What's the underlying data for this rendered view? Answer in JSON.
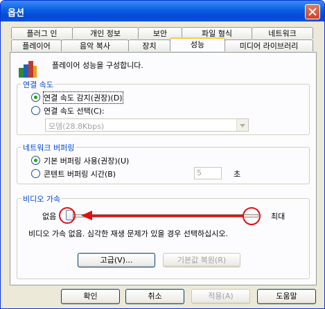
{
  "window": {
    "title": "옵션"
  },
  "tabs_back": [
    "플러그 인",
    "개인 정보",
    "보안",
    "파일 형식",
    "네트워크"
  ],
  "tabs_front": [
    "플레이어",
    "음악 복사",
    "장치",
    "성능",
    "미디어 라이브러리"
  ],
  "active_tab": "성능",
  "heading": "플레이어 성능을 구성합니다.",
  "connection": {
    "legend": "연결 속도",
    "detect_label": "연결 속도 감지(권장)(D)",
    "choose_label": "연결 속도 선택(C):",
    "speed_value": "모뎀(28.8Kbps)"
  },
  "buffering": {
    "legend": "네트워크 버퍼링",
    "default_label": "기본 버퍼링 사용(권장)(U)",
    "custom_label": "콘텐트 버퍼링 시간(B)",
    "seconds_value": "5",
    "seconds_unit": "초"
  },
  "acceleration": {
    "legend": "비디오 가속",
    "min_label": "없음",
    "max_label": "최대",
    "level_fraction": 0.0,
    "description": "비디오 가속 없음. 심각한 재생 문제가 있을 경우 선택하십시오.",
    "advanced_label": "고급(V)...",
    "restore_label": "기본값 복원(R)"
  },
  "buttons": {
    "ok": "확인",
    "cancel": "취소",
    "apply": "적용(A)",
    "help": "도움말"
  },
  "colors": {
    "title_bar": "#0549d6",
    "legend_text": "#0046d5",
    "annotation_red": "#e01010"
  }
}
